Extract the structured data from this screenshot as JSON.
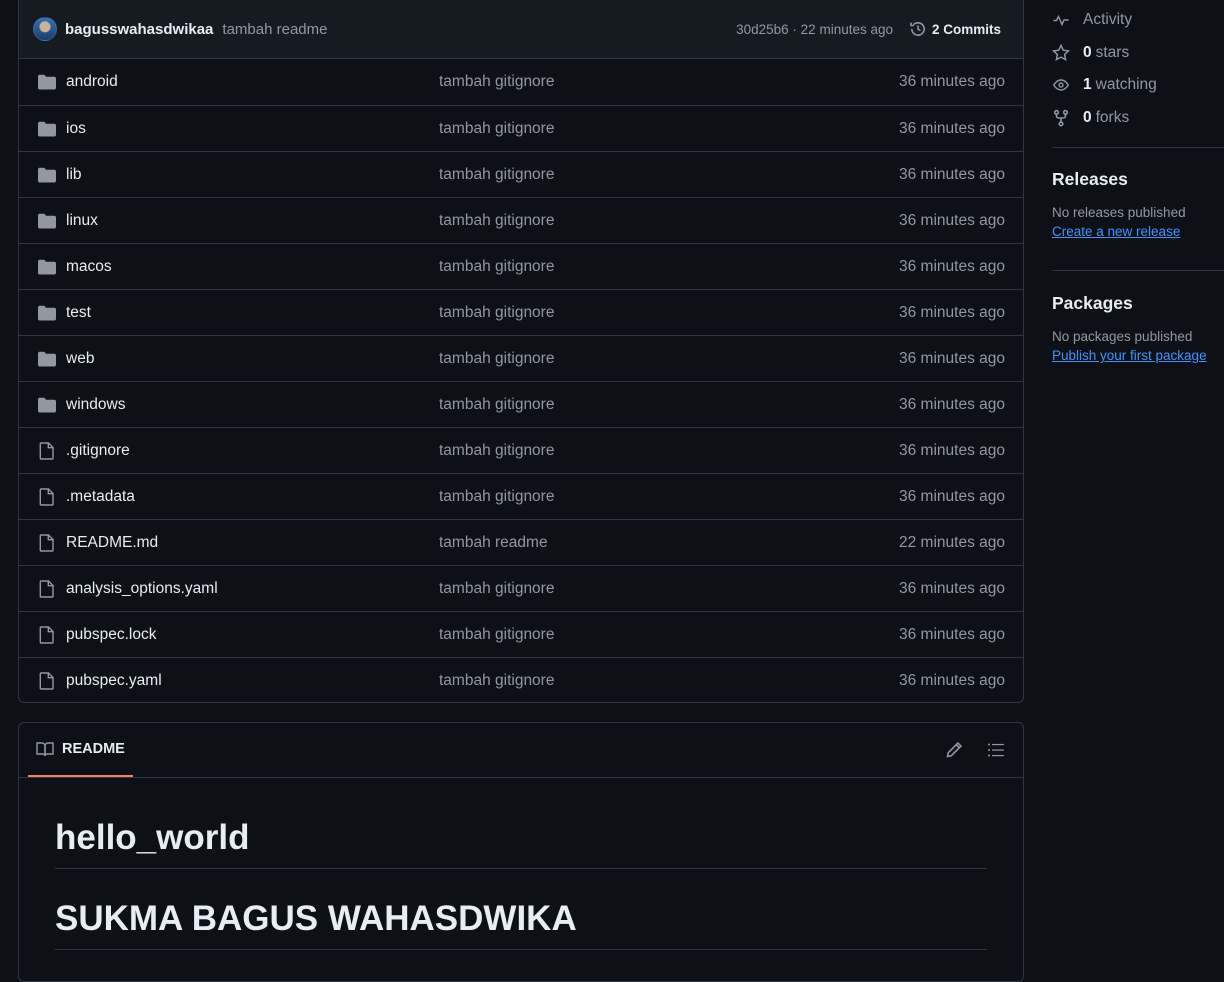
{
  "commit_bar": {
    "author": "bagusswahasdwikaa",
    "message": "tambah readme",
    "meta": "30d25b6 · 22 minutes ago",
    "commits_label": "2 Commits"
  },
  "files": [
    {
      "name": "android",
      "type": "folder",
      "commit": "tambah gitignore",
      "age": "36 minutes ago"
    },
    {
      "name": "ios",
      "type": "folder",
      "commit": "tambah gitignore",
      "age": "36 minutes ago"
    },
    {
      "name": "lib",
      "type": "folder",
      "commit": "tambah gitignore",
      "age": "36 minutes ago"
    },
    {
      "name": "linux",
      "type": "folder",
      "commit": "tambah gitignore",
      "age": "36 minutes ago"
    },
    {
      "name": "macos",
      "type": "folder",
      "commit": "tambah gitignore",
      "age": "36 minutes ago"
    },
    {
      "name": "test",
      "type": "folder",
      "commit": "tambah gitignore",
      "age": "36 minutes ago"
    },
    {
      "name": "web",
      "type": "folder",
      "commit": "tambah gitignore",
      "age": "36 minutes ago"
    },
    {
      "name": "windows",
      "type": "folder",
      "commit": "tambah gitignore",
      "age": "36 minutes ago"
    },
    {
      "name": ".gitignore",
      "type": "file",
      "commit": "tambah gitignore",
      "age": "36 minutes ago"
    },
    {
      "name": ".metadata",
      "type": "file",
      "commit": "tambah gitignore",
      "age": "36 minutes ago"
    },
    {
      "name": "README.md",
      "type": "file",
      "commit": "tambah readme",
      "age": "22 minutes ago"
    },
    {
      "name": "analysis_options.yaml",
      "type": "file",
      "commit": "tambah gitignore",
      "age": "36 minutes ago"
    },
    {
      "name": "pubspec.lock",
      "type": "file",
      "commit": "tambah gitignore",
      "age": "36 minutes ago"
    },
    {
      "name": "pubspec.yaml",
      "type": "file",
      "commit": "tambah gitignore",
      "age": "36 minutes ago"
    }
  ],
  "readme": {
    "tab_label": "README",
    "headings": [
      "hello_world",
      "SUKMA BAGUS WAHASDWIKA"
    ]
  },
  "sidebar": {
    "activity": "Activity",
    "stars_count": "0",
    "stars_label": "stars",
    "watching_count": "1",
    "watching_label": "watching",
    "forks_count": "0",
    "forks_label": "forks",
    "releases_title": "Releases",
    "releases_note": "No releases published",
    "releases_link": "Create a new release",
    "packages_title": "Packages",
    "packages_note": "No packages published",
    "packages_link": "Publish your first package"
  },
  "colors": {
    "background": "#0d1117",
    "border": "#30363d",
    "link": "#4493f8",
    "muted": "#9198a1",
    "tab_underline": "#f78166"
  }
}
